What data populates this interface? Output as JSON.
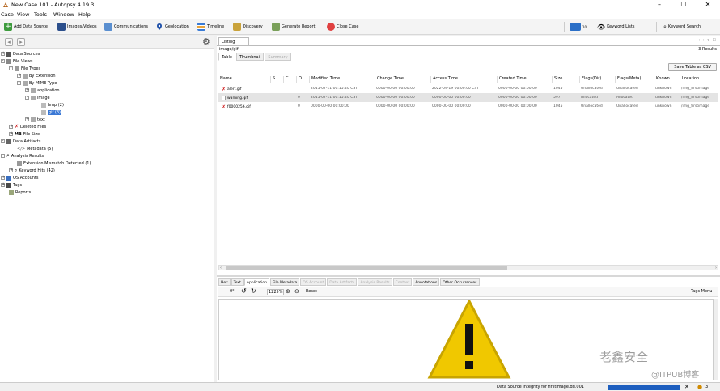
{
  "window": {
    "title": "New Case 101 - Autopsy 4.19.3"
  },
  "menu": [
    "Case",
    "View",
    "Tools",
    "Window",
    "Help"
  ],
  "toolbar": {
    "add_data_source": "Add Data Source",
    "images_videos": "Images/Videos",
    "communications": "Communications",
    "geolocation": "Geolocation",
    "timeline": "Timeline",
    "discovery": "Discovery",
    "generate_report": "Generate Report",
    "close_case": "Close Case",
    "keyword_lists": "Keyword Lists",
    "keyword_search": "Keyword Search",
    "count_badge": "10"
  },
  "tree": {
    "data_sources": "Data Sources",
    "file_views": "File Views",
    "file_types": "File Types",
    "by_extension": "By Extension",
    "by_mime_type": "By MIME Type",
    "application": "application",
    "image": "image",
    "bmp": "bmp (2)",
    "gif": "gif (3)",
    "text": "text",
    "deleted_files": "Deleted Files",
    "mb": "MB",
    "file_size": "File Size",
    "data_artifacts": "Data Artifacts",
    "metadata": "Metadata (5)",
    "analysis_results": "Analysis Results",
    "ext_mismatch": "Extension Mismatch Detected (1)",
    "keyword_hits": "Keyword Hits (42)",
    "os_accounts": "OS Accounts",
    "tags": "Tags",
    "reports": "Reports"
  },
  "listing": {
    "tab": "Listing",
    "path": "image/gif",
    "results": "3 Results",
    "subtabs": [
      "Table",
      "Thumbnail",
      "Summary"
    ],
    "save_csv": "Save Table as CSV",
    "columns": [
      "Name",
      "S",
      "C",
      "O",
      "Modified Time",
      "Change Time",
      "Access Time",
      "Created Time",
      "Size",
      "Flags(Dir)",
      "Flags(Meta)",
      "Known",
      "Location"
    ],
    "rows": [
      [
        "alert.gif",
        "",
        "",
        "",
        "2015-07-11 00:15:20 CST",
        "0000-00-00 00:00:00",
        "2022-09-19 00:00:00 CST",
        "0000-00-00 00:00:00",
        "1045",
        "Unallocated",
        "Unallocated",
        "unknown",
        "/img_firstimage"
      ],
      [
        "warning.gif",
        "",
        "",
        "0",
        "2015-07-11 00:15:20 CST",
        "0000-00-00 00:00:00",
        "0000-00-00 00:00:00",
        "0000-00-00 00:00:00",
        "597",
        "Allocated",
        "Allocated",
        "unknown",
        "/img_firstimage"
      ],
      [
        "f0000256.gif",
        "",
        "",
        "0",
        "0000-00-00 00:00:00",
        "0000-00-00 00:00:00",
        "0000-00-00 00:00:00",
        "0000-00-00 00:00:00",
        "1045",
        "Unallocated",
        "Unallocated",
        "unknown",
        "/img_firstimage"
      ]
    ]
  },
  "content_tabs": [
    "Hex",
    "Text",
    "Application",
    "File Metadata",
    "OS Account",
    "Data Artifacts",
    "Analysis Results",
    "Context",
    "Annotations",
    "Other Occurrences"
  ],
  "image_toolbar": {
    "rotation": "0°",
    "zoom": "1225%",
    "reset": "Reset",
    "tags_menu": "Tags Menu"
  },
  "status": {
    "integrity": "Data Source Integrity for firstimage.dd.001",
    "count": "3"
  },
  "watermarks": {
    "brand": "老鑫安全",
    "blog": "@ITPUB博客"
  }
}
